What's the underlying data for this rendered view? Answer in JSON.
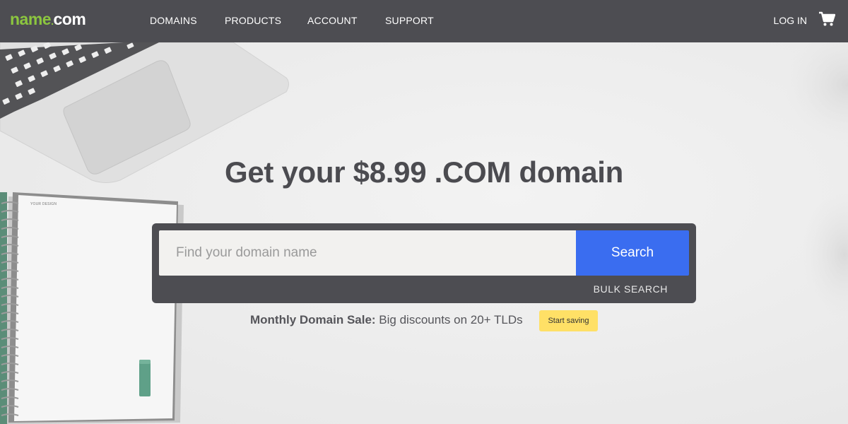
{
  "header": {
    "logo": {
      "name": "name",
      "dot": ".",
      "com": "com"
    },
    "nav": [
      "DOMAINS",
      "PRODUCTS",
      "ACCOUNT",
      "SUPPORT"
    ],
    "login": "LOG IN",
    "cart_icon": "cart-icon"
  },
  "hero": {
    "headline_pre": "Get your ",
    "headline_bold": "$8.99 .COM",
    "headline_post": " domain",
    "notebook_label": "YOUR DESIGN"
  },
  "search": {
    "placeholder": "Find your domain name",
    "value": "",
    "button_label": "Search",
    "bulk_label": "BULK SEARCH"
  },
  "promo": {
    "bold": "Monthly Domain Sale:",
    "text": " Big discounts on 20+ TLDs",
    "badge": "Start saving"
  },
  "colors": {
    "header_bg": "#4d4d52",
    "brand_green": "#8cc63f",
    "search_button": "#3a6df0",
    "badge": "#ffe066"
  }
}
